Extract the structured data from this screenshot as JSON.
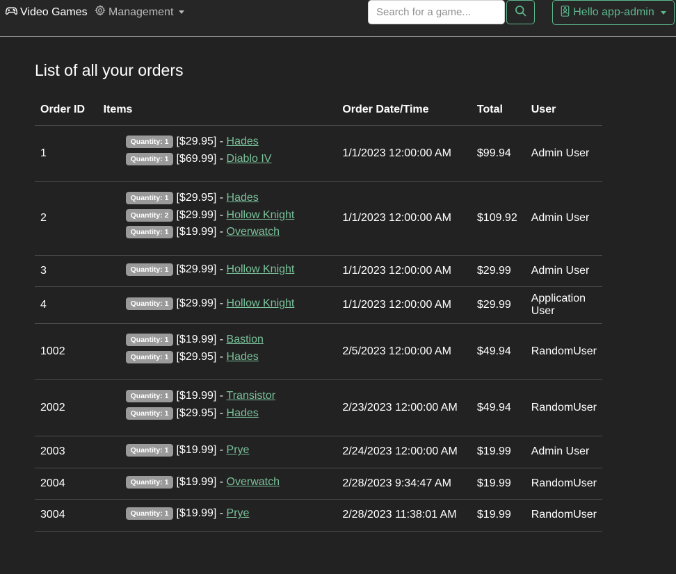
{
  "nav": {
    "brand": "Video Games",
    "management": "Management",
    "search_placeholder": "Search for a game...",
    "user_label": "Hello app-admin"
  },
  "colors": {
    "background": "#222222",
    "accent": "#5cb88e",
    "link": "#7ac29a",
    "badge": "#9a9a9a"
  },
  "page": {
    "title": "List of all your orders",
    "headers": {
      "order_id": "Order ID",
      "items": "Items",
      "date": "Order Date/Time",
      "total": "Total",
      "user": "User"
    }
  },
  "orders": [
    {
      "id": "1",
      "date": "1/1/2023 12:00:00 AM",
      "total": "$99.94",
      "user": "Admin User",
      "items": [
        {
          "qty": "Quantity: 1",
          "price": "[$29.95] - ",
          "name": "Hades"
        },
        {
          "qty": "Quantity: 1",
          "price": "[$69.99] - ",
          "name": "Diablo IV"
        }
      ]
    },
    {
      "id": "2",
      "date": "1/1/2023 12:00:00 AM",
      "total": "$109.92",
      "user": "Admin User",
      "items": [
        {
          "qty": "Quantity: 1",
          "price": "[$29.95] - ",
          "name": "Hades"
        },
        {
          "qty": "Quantity: 2",
          "price": "[$29.99] - ",
          "name": "Hollow Knight"
        },
        {
          "qty": "Quantity: 1",
          "price": "[$19.99] - ",
          "name": "Overwatch"
        }
      ]
    },
    {
      "id": "3",
      "date": "1/1/2023 12:00:00 AM",
      "total": "$29.99",
      "user": "Admin User",
      "items": [
        {
          "qty": "Quantity: 1",
          "price": "[$29.99] - ",
          "name": "Hollow Knight"
        }
      ]
    },
    {
      "id": "4",
      "date": "1/1/2023 12:00:00 AM",
      "total": "$29.99",
      "user": "Application User",
      "items": [
        {
          "qty": "Quantity: 1",
          "price": "[$29.99] - ",
          "name": "Hollow Knight"
        }
      ]
    },
    {
      "id": "1002",
      "date": "2/5/2023 12:00:00 AM",
      "total": "$49.94",
      "user": "RandomUser",
      "items": [
        {
          "qty": "Quantity: 1",
          "price": "[$19.99] - ",
          "name": "Bastion"
        },
        {
          "qty": "Quantity: 1",
          "price": "[$29.95] - ",
          "name": "Hades"
        }
      ]
    },
    {
      "id": "2002",
      "date": "2/23/2023 12:00:00 AM",
      "total": "$49.94",
      "user": "RandomUser",
      "items": [
        {
          "qty": "Quantity: 1",
          "price": "[$19.99] - ",
          "name": "Transistor"
        },
        {
          "qty": "Quantity: 1",
          "price": "[$29.95] - ",
          "name": "Hades"
        }
      ]
    },
    {
      "id": "2003",
      "date": "2/24/2023 12:00:00 AM",
      "total": "$19.99",
      "user": "Admin User",
      "items": [
        {
          "qty": "Quantity: 1",
          "price": "[$19.99] - ",
          "name": "Prye"
        }
      ]
    },
    {
      "id": "2004",
      "date": "2/28/2023 9:34:47 AM",
      "total": "$19.99",
      "user": "RandomUser",
      "items": [
        {
          "qty": "Quantity: 1",
          "price": "[$19.99] - ",
          "name": "Overwatch"
        }
      ]
    },
    {
      "id": "3004",
      "date": "2/28/2023 11:38:01 AM",
      "total": "$19.99",
      "user": "RandomUser",
      "items": [
        {
          "qty": "Quantity: 1",
          "price": "[$19.99] - ",
          "name": "Prye"
        }
      ]
    }
  ]
}
